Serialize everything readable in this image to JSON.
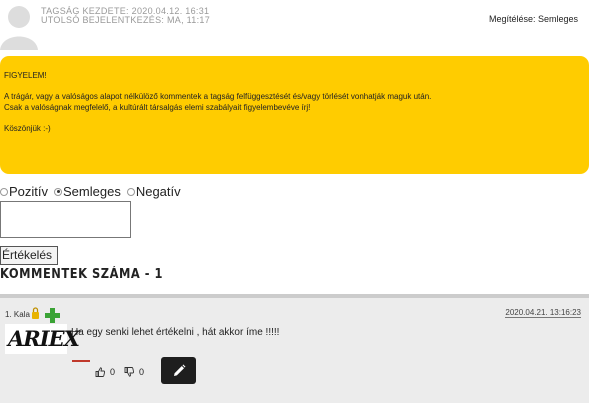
{
  "profile": {
    "member_since": "TAGSÁG KEZDETE: 2020.04.12. 16:31",
    "last_login": "UTOLSÓ BEJELENTKEZÉS: MA, 11:17",
    "rating": "Megítélése: Semleges"
  },
  "warning": {
    "title": "FIGYELEM!",
    "line1": "A trágár, vagy a valóságos alapot nélkülöző kommentek a tagság felfüggesztését és/vagy törlését vonhatják maguk után.",
    "line2": "Csak a valóságnak megfelelő, a kultúrált társalgás elemi szabályait figyelembevéve írj!",
    "thanks": "Köszönjük :-)",
    "bg_color": "#ffcc00"
  },
  "rating_form": {
    "options": [
      "Pozitív",
      "Semleges",
      "Negatív"
    ],
    "selected": "Semleges",
    "comment_value": "",
    "submit_label": "Értékelés"
  },
  "comments_header": "KOMMENTEK SZÁMA - 1",
  "comment": {
    "author": "1. Kala",
    "avatar_logo": "ARIEX",
    "date": "2020.04.21. 13:16:23",
    "text": "Ha egy senki lehet értékelni , hát akkor íme !!!!!",
    "likes": "0",
    "dislikes": "0"
  }
}
